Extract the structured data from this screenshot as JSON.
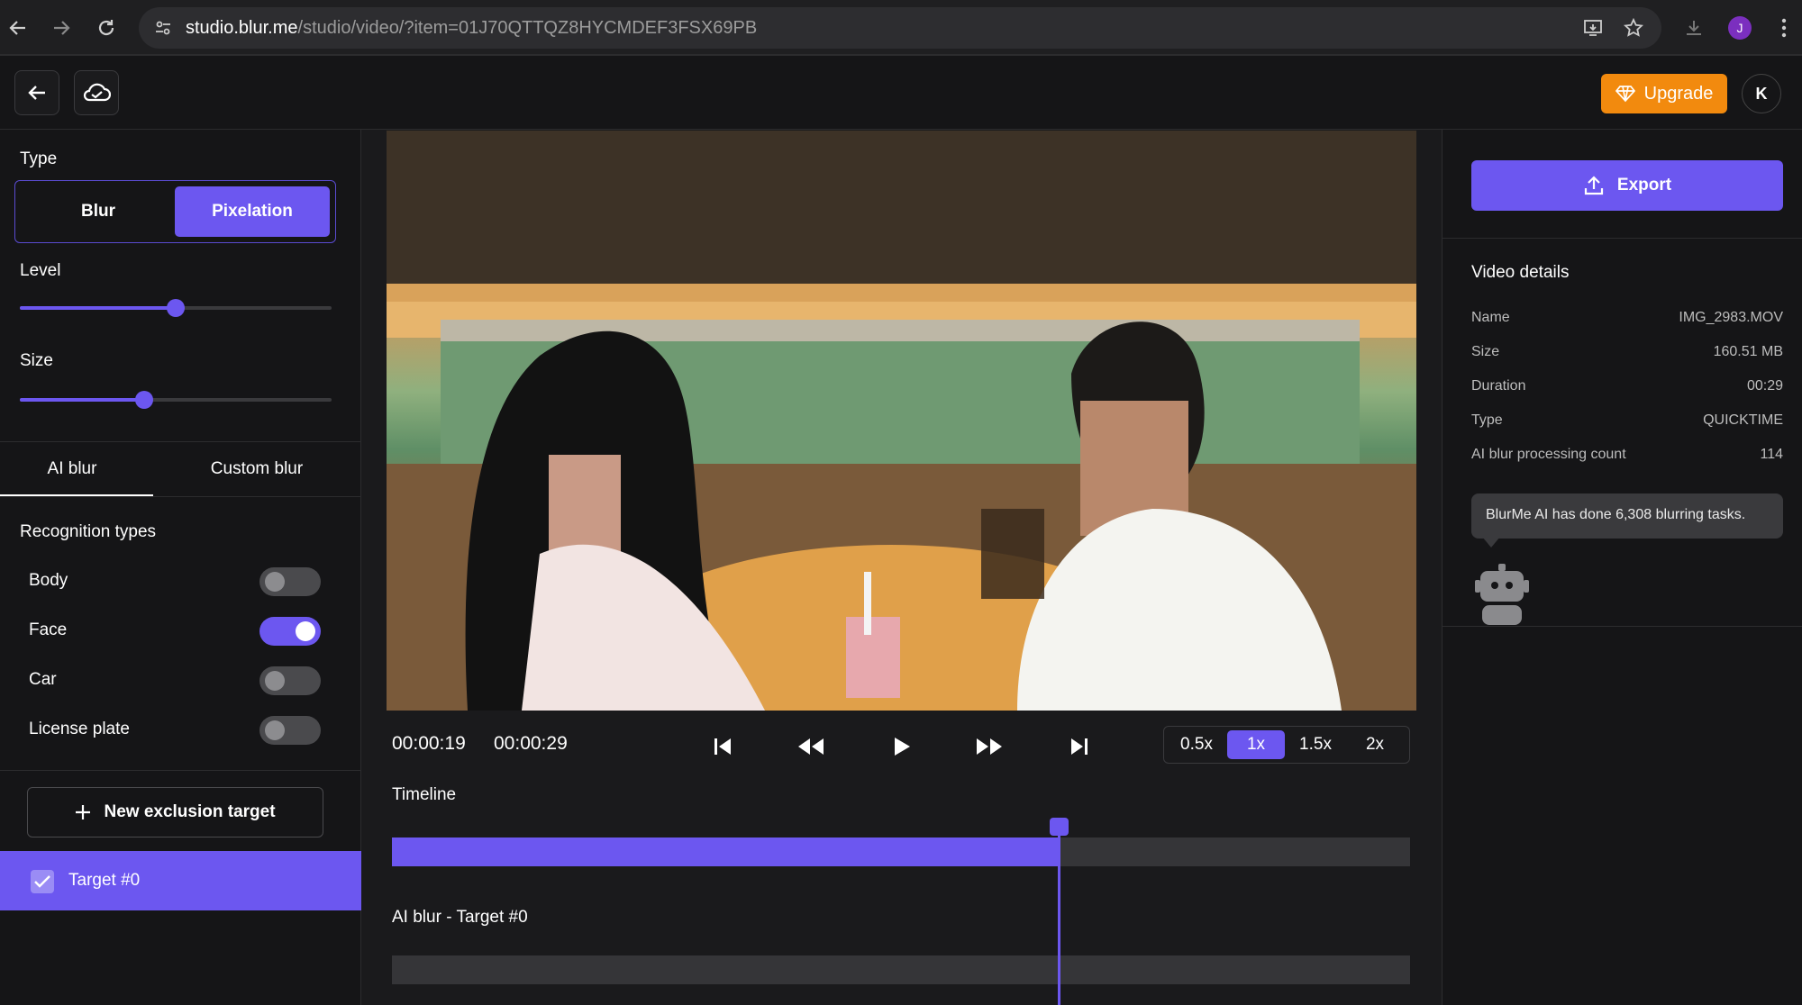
{
  "browser": {
    "url_host": "studio.blur.me",
    "url_path": "/studio/video/?item=01J70QTTQZ8HYCMDEF3FSX69PB",
    "profile_initial": "J"
  },
  "header": {
    "upgrade_label": "Upgrade",
    "avatar_initial": "K"
  },
  "left": {
    "type_label": "Type",
    "type_options": [
      "Blur",
      "Pixelation"
    ],
    "type_selected": "Pixelation",
    "level_label": "Level",
    "level_value": 0.5,
    "size_label": "Size",
    "size_value": 0.4,
    "tabs": [
      "AI blur",
      "Custom blur"
    ],
    "recognition_label": "Recognition types",
    "recognition": [
      {
        "label": "Body",
        "on": false
      },
      {
        "label": "Face",
        "on": true
      },
      {
        "label": "Car",
        "on": false
      },
      {
        "label": "License plate",
        "on": false
      }
    ],
    "new_exclusion_label": "New exclusion target",
    "target_label": "Target #0"
  },
  "player": {
    "current_time": "00:00:19",
    "total_time": "00:00:29",
    "speeds": [
      "0.5x",
      "1x",
      "1.5x",
      "2x"
    ],
    "speed_selected": "1x",
    "timeline_label": "Timeline",
    "track_label": "AI blur - Target #0",
    "progress": 0.655
  },
  "right": {
    "export_label": "Export",
    "details_title": "Video details",
    "details": [
      {
        "k": "Name",
        "v": "IMG_2983.MOV"
      },
      {
        "k": "Size",
        "v": "160.51 MB"
      },
      {
        "k": "Duration",
        "v": "00:29"
      },
      {
        "k": "Type",
        "v": "QUICKTIME"
      },
      {
        "k": "AI blur processing count",
        "v": "114"
      }
    ],
    "tooltip": "BlurMe AI has done 6,308 blurring tasks."
  },
  "colors": {
    "accent": "#6c57f0",
    "upgrade": "#f28a0e"
  }
}
